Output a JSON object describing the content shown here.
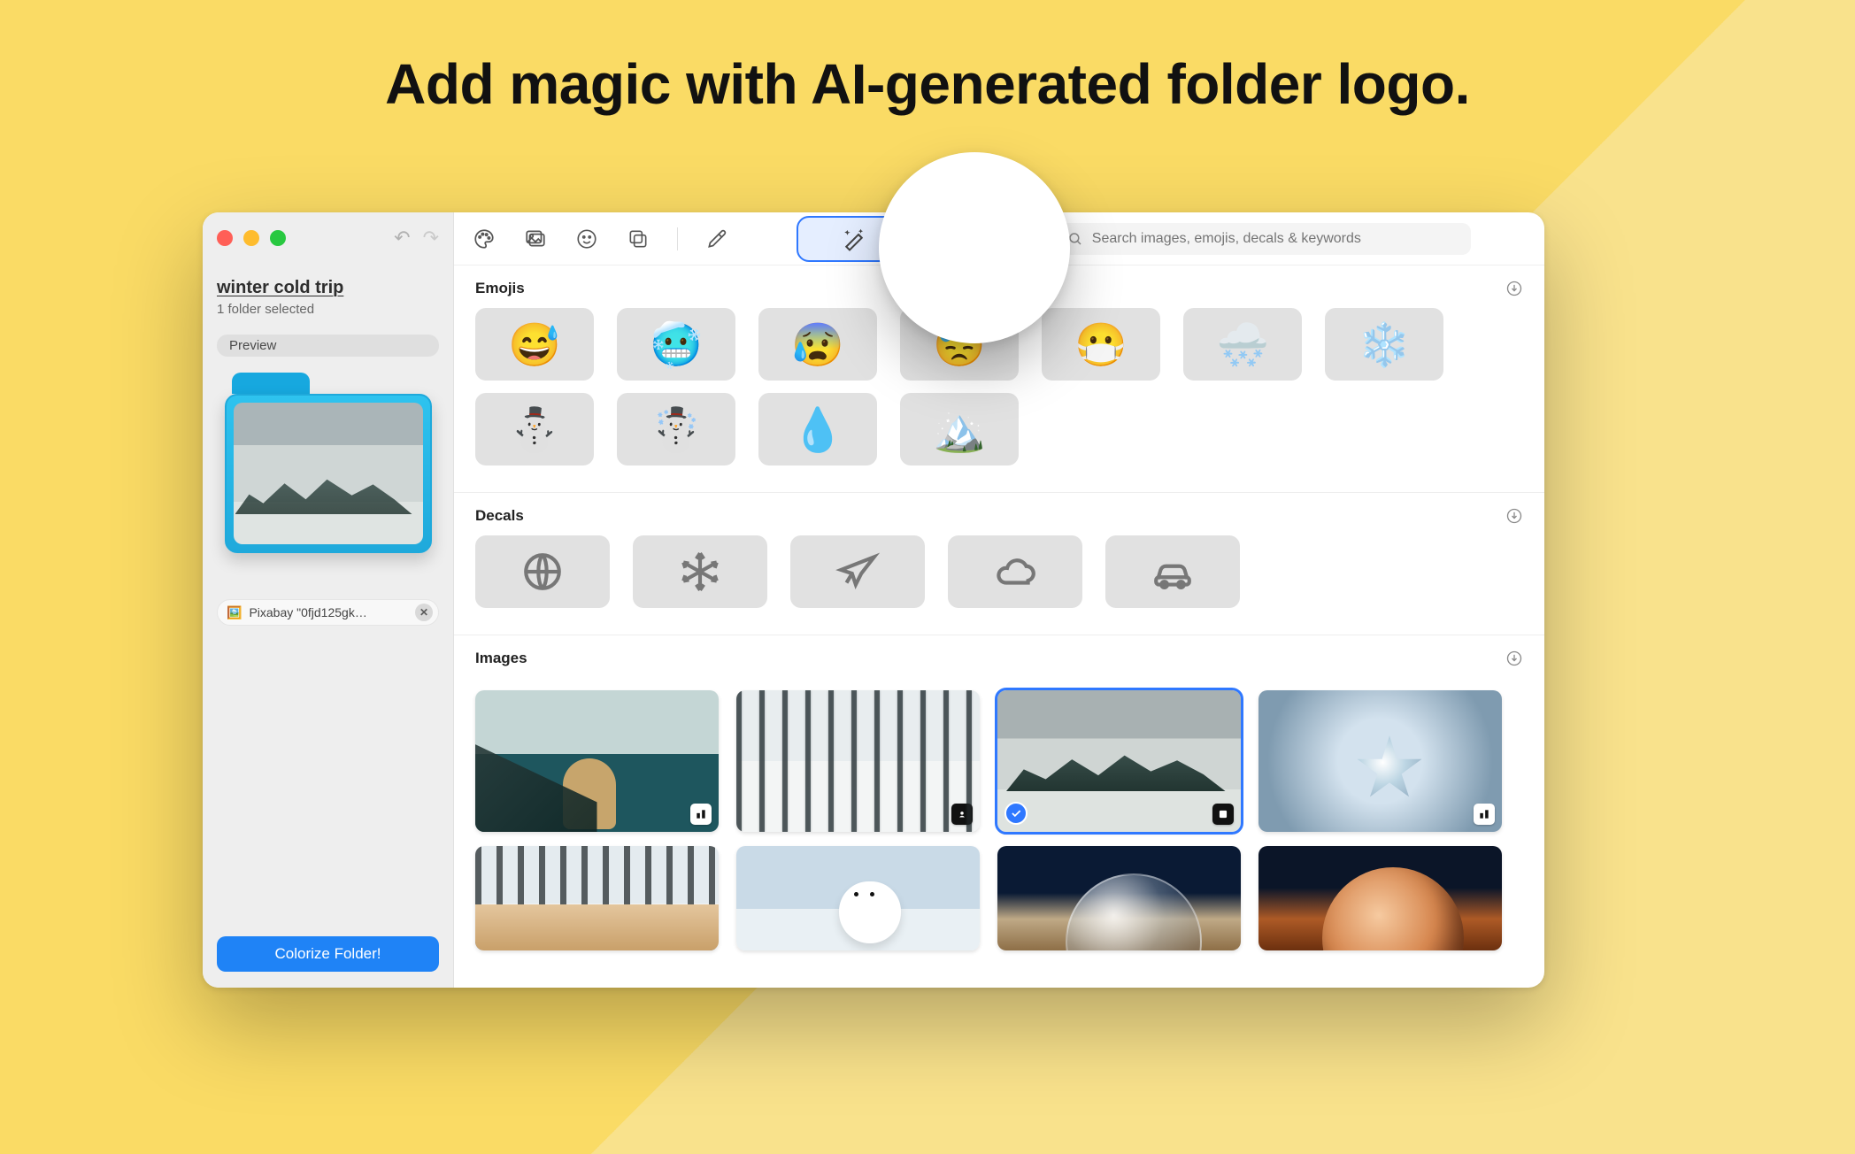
{
  "headline": "Add magic with AI-generated folder logo.",
  "sidebar": {
    "folder_name": "winter cold trip",
    "selection_info": "1 folder selected",
    "preview_chip": "Preview",
    "tag": {
      "label": "Pixabay \"0fjd125gk…"
    },
    "action_button": "Colorize Folder!"
  },
  "toolbar": {
    "search_placeholder": "Search images, emojis, decals & keywords"
  },
  "sections": {
    "emojis": {
      "title": "Emojis",
      "items_row1": [
        "😅",
        "🥶",
        "😰",
        "😓",
        "😷",
        "🌨️",
        "❄️"
      ],
      "items_row2": [
        "⛄",
        "☃️",
        "💧",
        "🏔️"
      ]
    },
    "decals": {
      "title": "Decals"
    },
    "images": {
      "title": "Images"
    }
  }
}
